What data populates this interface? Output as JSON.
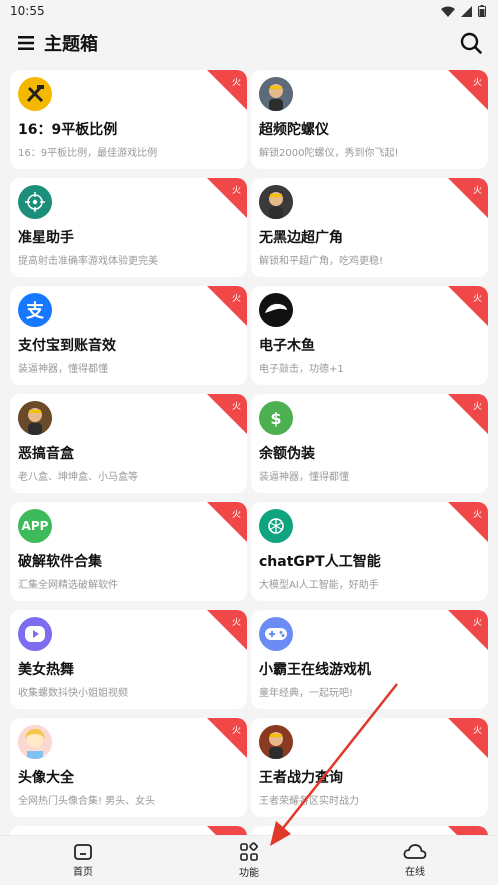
{
  "status_bar": {
    "time": "10:55"
  },
  "app_bar": {
    "title": "主题箱"
  },
  "hot_label": "火",
  "cards": [
    {
      "title": "16：9平板比例",
      "desc": "16：9平板比例，最佳游戏比例",
      "icon": "tools-icon",
      "icon_color": "#f5b800",
      "icon_text": ""
    },
    {
      "title": "超频陀螺仪",
      "desc": "解锁2000陀螺仪，秀到你飞起!",
      "icon": "character-avatar-icon",
      "icon_color": "#5c6a7a",
      "icon_text": ""
    },
    {
      "title": "准星助手",
      "desc": "提高射击准确率游戏体验更完美",
      "icon": "crosshair-icon",
      "icon_color": "#1c8f7a",
      "icon_text": ""
    },
    {
      "title": "无黑边超广角",
      "desc": "解锁和平超广角，吃鸡更稳!",
      "icon": "helmet-avatar-icon",
      "icon_color": "#3a3a3a",
      "icon_text": ""
    },
    {
      "title": "支付宝到账音效",
      "desc": "装逼神器，懂得都懂",
      "icon": "alipay-icon",
      "icon_color": "#1677ff",
      "icon_text": "支"
    },
    {
      "title": "电子木鱼",
      "desc": "电子敲击，功德+1",
      "icon": "wooden-fish-icon",
      "icon_color": "#111111",
      "icon_text": ""
    },
    {
      "title": "恶搞音盒",
      "desc": "老八盒、坤坤盒、小马盒等",
      "icon": "face-avatar-icon",
      "icon_color": "#6b4a2a",
      "icon_text": ""
    },
    {
      "title": "余额伪装",
      "desc": "装逼神器，懂得都懂",
      "icon": "money-bag-icon",
      "icon_color": "#4caf50",
      "icon_text": "$"
    },
    {
      "title": "破解软件合集",
      "desc": "汇集全网精选破解软件",
      "icon": "app-icon",
      "icon_color": "#3dbb5a",
      "icon_text": "APP"
    },
    {
      "title": "chatGPT人工智能",
      "desc": "大模型AI人工智能，好助手",
      "icon": "openai-icon",
      "icon_color": "#10a37f",
      "icon_text": ""
    },
    {
      "title": "美女热舞",
      "desc": "收集螺数抖快小姐姐视频",
      "icon": "play-icon",
      "icon_color": "#7b6cf0",
      "icon_text": ""
    },
    {
      "title": "小霸王在线游戏机",
      "desc": "童年经典，一起玩吧!",
      "icon": "gamepad-icon",
      "icon_color": "#6b8cf5",
      "icon_text": ""
    },
    {
      "title": "头像大全",
      "desc": "全网热门头像合集! 男头、女头",
      "icon": "girl-avatar-icon",
      "icon_color": "#f6b7b7",
      "icon_text": ""
    },
    {
      "title": "王者战力查询",
      "desc": "王者荣耀各区实时战力",
      "icon": "hero-avatar-icon",
      "icon_color": "#8a3a20",
      "icon_text": ""
    }
  ],
  "bottom_nav": {
    "home": "首页",
    "features": "功能",
    "online": "在线"
  },
  "colors": {
    "hot_ribbon": "#f04848",
    "annotation_arrow": "#e0392b"
  }
}
